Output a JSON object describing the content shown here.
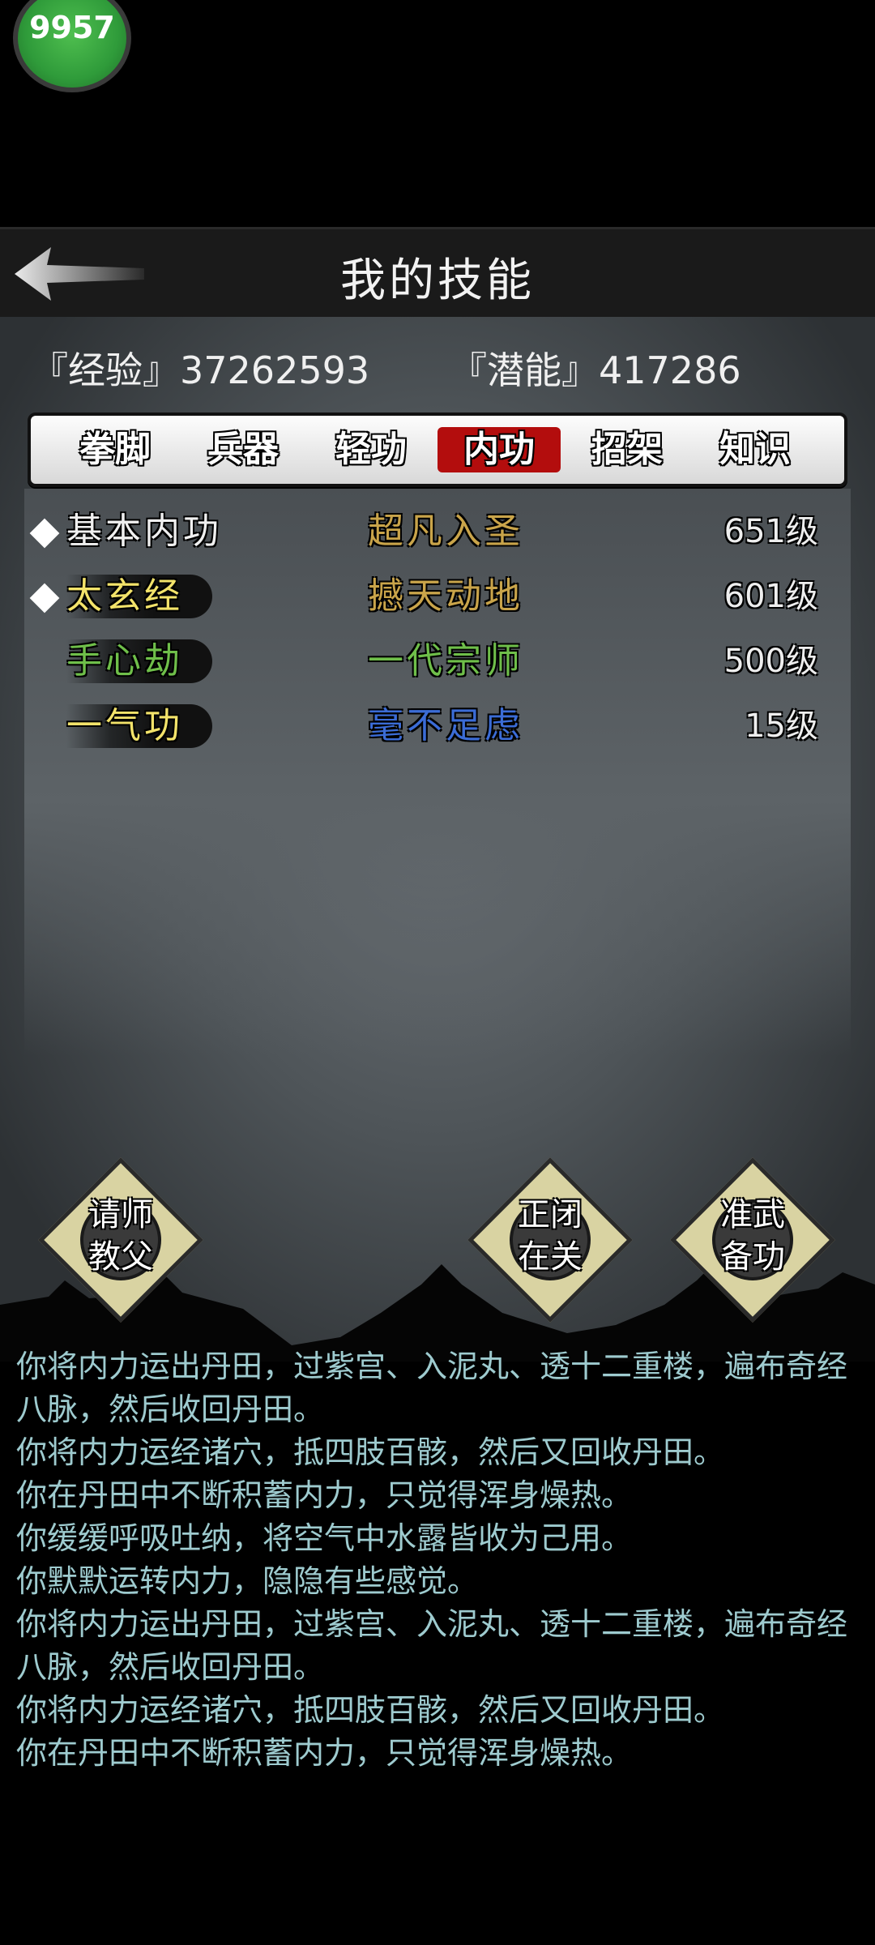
{
  "badge": {
    "text": "9957"
  },
  "header": {
    "title": "我的技能"
  },
  "stats": {
    "experience": "『经验』37262593",
    "potential": "『潜能』417286"
  },
  "tabs": [
    {
      "label": "拳脚",
      "active": false
    },
    {
      "label": "兵器",
      "active": false
    },
    {
      "label": "轻功",
      "active": false
    },
    {
      "label": "内功",
      "active": true
    },
    {
      "label": "招架",
      "active": false
    },
    {
      "label": "知识",
      "active": false
    }
  ],
  "skills": [
    {
      "name": "基本内功",
      "rank": "超凡入圣",
      "level": "651级",
      "name_color": "#f0f0f0",
      "rank_color": "#c9a44a",
      "marked": true
    },
    {
      "name": "太玄经",
      "rank": "撼天动地",
      "level": "601级",
      "name_color": "#f3e36a",
      "rank_color": "#c9a44a",
      "marked": true
    },
    {
      "name": "手心劫",
      "rank": "一代宗师",
      "level": "500级",
      "name_color": "#6fbf4a",
      "rank_color": "#6fbf4a",
      "marked": false
    },
    {
      "name": "一气功",
      "rank": "毫不足虑",
      "level": "15级",
      "name_color": "#f3e36a",
      "rank_color": "#3b6cd6",
      "marked": false
    }
  ],
  "actions": {
    "teacher": "请师\n教父",
    "closed": "正闭\n在关",
    "prepare": "准武\n备功"
  },
  "log": [
    "你将内力运出丹田，过紫宫、入泥丸、透十二重楼，遍布奇经八脉，然后收回丹田。",
    "你将内力运经诸穴，抵四肢百骸，然后又回收丹田。",
    "你在丹田中不断积蓄内力，只觉得浑身燥热。",
    "你缓缓呼吸吐纳，将空气中水露皆收为己用。",
    "你默默运转内力，隐隐有些感觉。",
    "你将内力运出丹田，过紫宫、入泥丸、透十二重楼，遍布奇经八脉，然后收回丹田。",
    "你将内力运经诸穴，抵四肢百骸，然后又回收丹田。",
    "你在丹田中不断积蓄内力，只觉得浑身燥热。"
  ],
  "colors": {
    "active_tab": "#b30d0d",
    "log_text": "#9ecbcf"
  }
}
